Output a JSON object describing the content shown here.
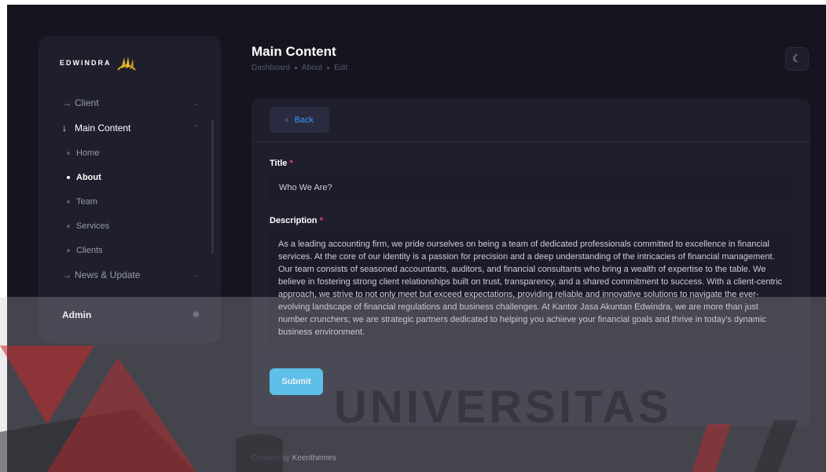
{
  "brand": {
    "name": "EDWINDRA"
  },
  "sidebar": {
    "items": [
      {
        "label": "Client"
      },
      {
        "label": "Main Content"
      },
      {
        "label": "News & Update"
      }
    ],
    "subitems": [
      {
        "label": "Home"
      },
      {
        "label": "About"
      },
      {
        "label": "Team"
      },
      {
        "label": "Services"
      },
      {
        "label": "Clients"
      }
    ],
    "user": "Admin"
  },
  "header": {
    "title": "Main Content",
    "breadcrumb": [
      "Dashboard",
      "About",
      "Edit"
    ]
  },
  "form": {
    "back_label": "Back",
    "title_label": "Title",
    "title_value": "Who We Are?",
    "description_label": "Description",
    "description_value": "As a leading accounting firm, we pride ourselves on being a team of dedicated professionals committed to excellence in financial services. At the core of our identity is a passion for precision and a deep understanding of the intricacies of financial management. Our team consists of seasoned accountants, auditors, and financial consultants who bring a wealth of expertise to the table. We believe in fostering strong client relationships built on trust, transparency, and a shared commitment to success. With a client-centric approach, we strive to not only meet but exceed expectations, providing reliable and innovative solutions to navigate the ever-evolving landscape of financial regulations and business challenges. At Kantor Jasa Akuntan Edwindra, we are more than just number crunchers; we are strategic partners dedicated to helping you achieve your financial goals and thrive in today's dynamic business environment.",
    "required_mark": "*",
    "submit_label": "Submit"
  },
  "footer": {
    "prefix": "Created by",
    "link": "Keenthemes"
  },
  "watermark": {
    "text": "UNIVERSITAS"
  },
  "colors": {
    "accent": "#3699ff",
    "submit": "#3abff8",
    "required": "#f1416c",
    "bg": "#15151f",
    "card": "#1e1e2d"
  },
  "icons": {
    "theme_toggle": "moon-icon",
    "user_menu": "sun-icon",
    "back": "chevron-left-icon"
  }
}
